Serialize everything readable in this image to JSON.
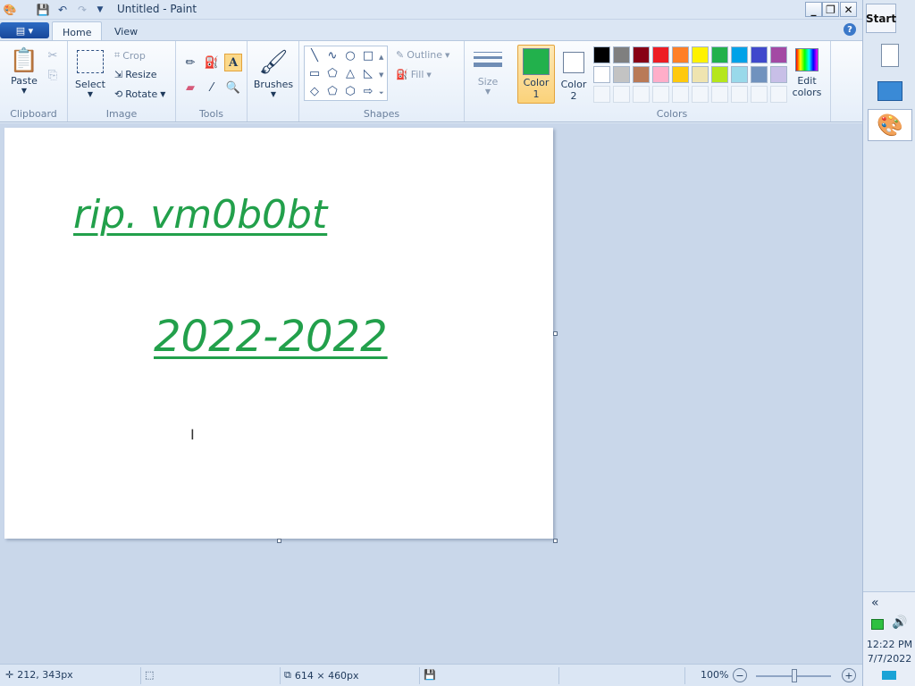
{
  "window": {
    "title": "Untitled - Paint"
  },
  "tabs": [
    {
      "label": "Home"
    },
    {
      "label": "View"
    }
  ],
  "ribbon": {
    "clipboard": {
      "group": "Clipboard",
      "paste": "Paste"
    },
    "image": {
      "group": "Image",
      "select": "Select",
      "crop": "Crop",
      "resize": "Resize",
      "rotate": "Rotate"
    },
    "tools": {
      "group": "Tools"
    },
    "brushes": {
      "label": "Brushes"
    },
    "shapes": {
      "group": "Shapes",
      "outline": "Outline",
      "fill": "Fill"
    },
    "size": {
      "label": "Size"
    },
    "colors": {
      "group": "Colors",
      "color1": "Color 1",
      "color1_label_a": "Color",
      "color1_label_b": "1",
      "color2_label_a": "Color",
      "color2_label_b": "2",
      "edit_a": "Edit",
      "edit_b": "colors",
      "color1_value": "#22b14c",
      "color2_value": "#ffffff",
      "palette_row1": [
        "#000000",
        "#7f7f7f",
        "#880015",
        "#ed1c24",
        "#ff7f27",
        "#fff200",
        "#22b14c",
        "#00a2e8",
        "#3f48cc",
        "#a349a4"
      ],
      "palette_row2": [
        "#ffffff",
        "#c3c3c3",
        "#b97a57",
        "#ffaec9",
        "#ffc90e",
        "#efe4b0",
        "#b5e61d",
        "#99d9ea",
        "#7092be",
        "#c8bfe7"
      ]
    }
  },
  "canvas": {
    "line1": "rip. vm0b0bt",
    "line2": "2022-2022",
    "text_color": "#22a04b"
  },
  "status": {
    "cursor_pos": "212, 343px",
    "canvas_size": "614 × 460px",
    "zoom": "100%"
  },
  "taskbar": {
    "start": "Start",
    "time": "12:22 PM",
    "date": "7/7/2022",
    "collapse": "«"
  }
}
